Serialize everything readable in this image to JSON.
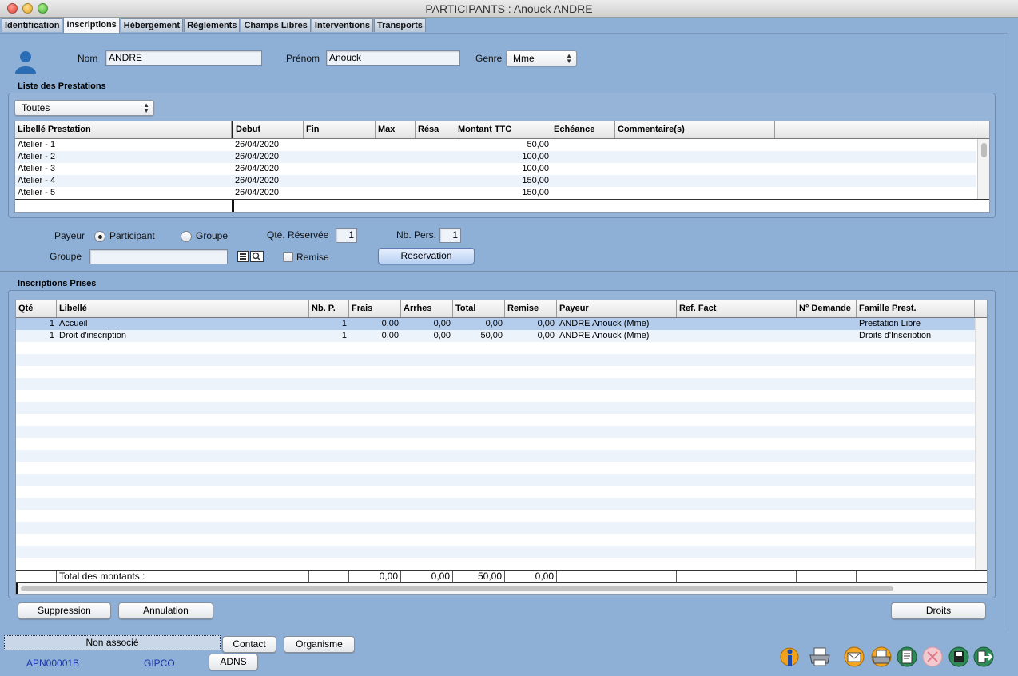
{
  "window": {
    "title": "PARTICIPANTS : Anouck ANDRE"
  },
  "tabs": [
    "Identification",
    "Inscriptions",
    "Hébergement",
    "Règlements",
    "Champs Libres",
    "Interventions",
    "Transports"
  ],
  "header": {
    "nom_label": "Nom",
    "nom_value": "ANDRE",
    "prenom_label": "Prénom",
    "prenom_value": "Anouck",
    "genre_label": "Genre",
    "genre_value": "Mme"
  },
  "prestations": {
    "title": "Liste des Prestations",
    "filter": "Toutes",
    "columns": [
      "Libellé Prestation",
      "Debut",
      "Fin",
      "Max",
      "Résa",
      "Montant TTC",
      "Echéance",
      "Commentaire(s)"
    ],
    "rows": [
      {
        "libelle": "Atelier - 1",
        "debut": "26/04/2020",
        "montant": "50,00"
      },
      {
        "libelle": "Atelier - 2",
        "debut": "26/04/2020",
        "montant": "100,00"
      },
      {
        "libelle": "Atelier - 3",
        "debut": "26/04/2020",
        "montant": "100,00"
      },
      {
        "libelle": "Atelier - 4",
        "debut": "26/04/2020",
        "montant": "150,00"
      },
      {
        "libelle": "Atelier - 5",
        "debut": "26/04/2020",
        "montant": "150,00"
      }
    ]
  },
  "booking": {
    "payeur_label": "Payeur",
    "payeur_options": [
      "Participant",
      "Groupe"
    ],
    "payeur_selected": "Participant",
    "qte_label": "Qté. Réservée",
    "qte_value": "1",
    "nbpers_label": "Nb. Pers.",
    "nbpers_value": "1",
    "groupe_label": "Groupe",
    "groupe_value": "",
    "remise_label": "Remise",
    "reservation_button": "Reservation"
  },
  "inscriptions": {
    "title": "Inscriptions Prises",
    "columns": [
      "Qté",
      "Libellé",
      "Nb. P.",
      "Frais",
      "Arrhes",
      "Total",
      "Remise",
      "Payeur",
      "Ref. Fact",
      "N° Demande",
      "Famille Prest."
    ],
    "rows": [
      {
        "qte": "1",
        "libelle": "Accueil",
        "nbp": "1",
        "frais": "0,00",
        "arrhes": "0,00",
        "total": "0,00",
        "remise": "0,00",
        "payeur": "ANDRE Anouck (Mme)",
        "ref": "",
        "demande": "",
        "famille": "Prestation Libre"
      },
      {
        "qte": "1",
        "libelle": "Droit d'inscription",
        "nbp": "1",
        "frais": "0,00",
        "arrhes": "0,00",
        "total": "50,00",
        "remise": "0,00",
        "payeur": "ANDRE Anouck (Mme)",
        "ref": "",
        "demande": "",
        "famille": "Droits d'Inscription"
      }
    ],
    "totals": {
      "label": "Total des montants :",
      "frais": "0,00",
      "arrhes": "0,00",
      "total": "50,00",
      "remise": "0,00"
    }
  },
  "buttons": {
    "suppression": "Suppression",
    "annulation": "Annulation",
    "droits": "Droits"
  },
  "footer": {
    "status": "Non associé",
    "contact": "Contact",
    "organisme": "Organisme",
    "adns": "ADNS",
    "code": "APN00001B",
    "org": "GIPCO"
  },
  "toolbar_icons": [
    "info-icon",
    "printer-icon",
    "mail-icon",
    "multi-print-icon",
    "export-icon",
    "disabled-icon",
    "save-icon",
    "exit-icon"
  ]
}
